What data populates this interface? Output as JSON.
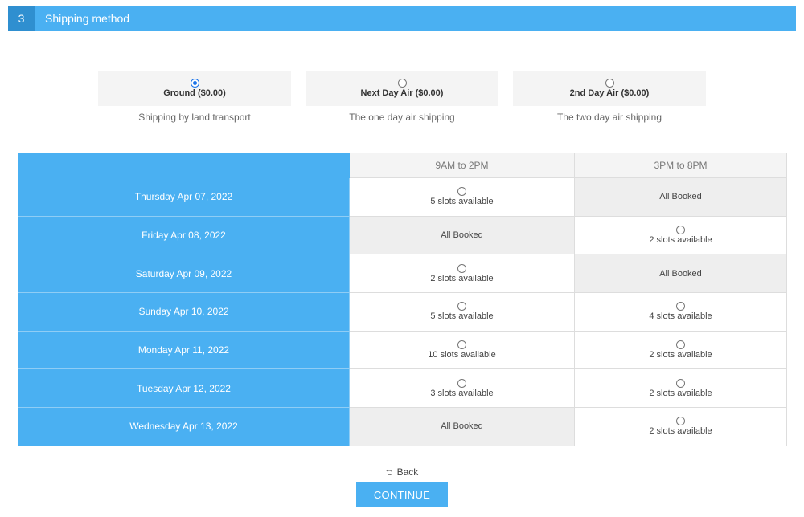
{
  "step": {
    "number": "3",
    "title": "Shipping method"
  },
  "methods": [
    {
      "label": "Ground ($0.00)",
      "description": "Shipping by land transport",
      "selected": true
    },
    {
      "label": "Next Day Air ($0.00)",
      "description": "The one day air shipping",
      "selected": false
    },
    {
      "label": "2nd Day Air ($0.00)",
      "description": "The two day air shipping",
      "selected": false
    }
  ],
  "table": {
    "columns": [
      "9AM to 2PM",
      "3PM to 8PM"
    ],
    "rows": [
      {
        "date": "Thursday Apr 07, 2022",
        "slots": [
          "5 slots available",
          "All Booked"
        ]
      },
      {
        "date": "Friday Apr 08, 2022",
        "slots": [
          "All Booked",
          "2 slots available"
        ]
      },
      {
        "date": "Saturday Apr 09, 2022",
        "slots": [
          "2 slots available",
          "All Booked"
        ]
      },
      {
        "date": "Sunday Apr 10, 2022",
        "slots": [
          "5 slots available",
          "4 slots available"
        ]
      },
      {
        "date": "Monday Apr 11, 2022",
        "slots": [
          "10 slots available",
          "2 slots available"
        ]
      },
      {
        "date": "Tuesday Apr 12, 2022",
        "slots": [
          "3 slots available",
          "2 slots available"
        ]
      },
      {
        "date": "Wednesday Apr 13, 2022",
        "slots": [
          "All Booked",
          "2 slots available"
        ]
      }
    ]
  },
  "actions": {
    "back_label": "Back",
    "back_icon": "back-arrow-icon",
    "continue_label": "CONTINUE"
  },
  "colors": {
    "accent": "#4ab0f2",
    "accent_dark": "#2f8fd0",
    "booked_bg": "#eeeeee"
  }
}
